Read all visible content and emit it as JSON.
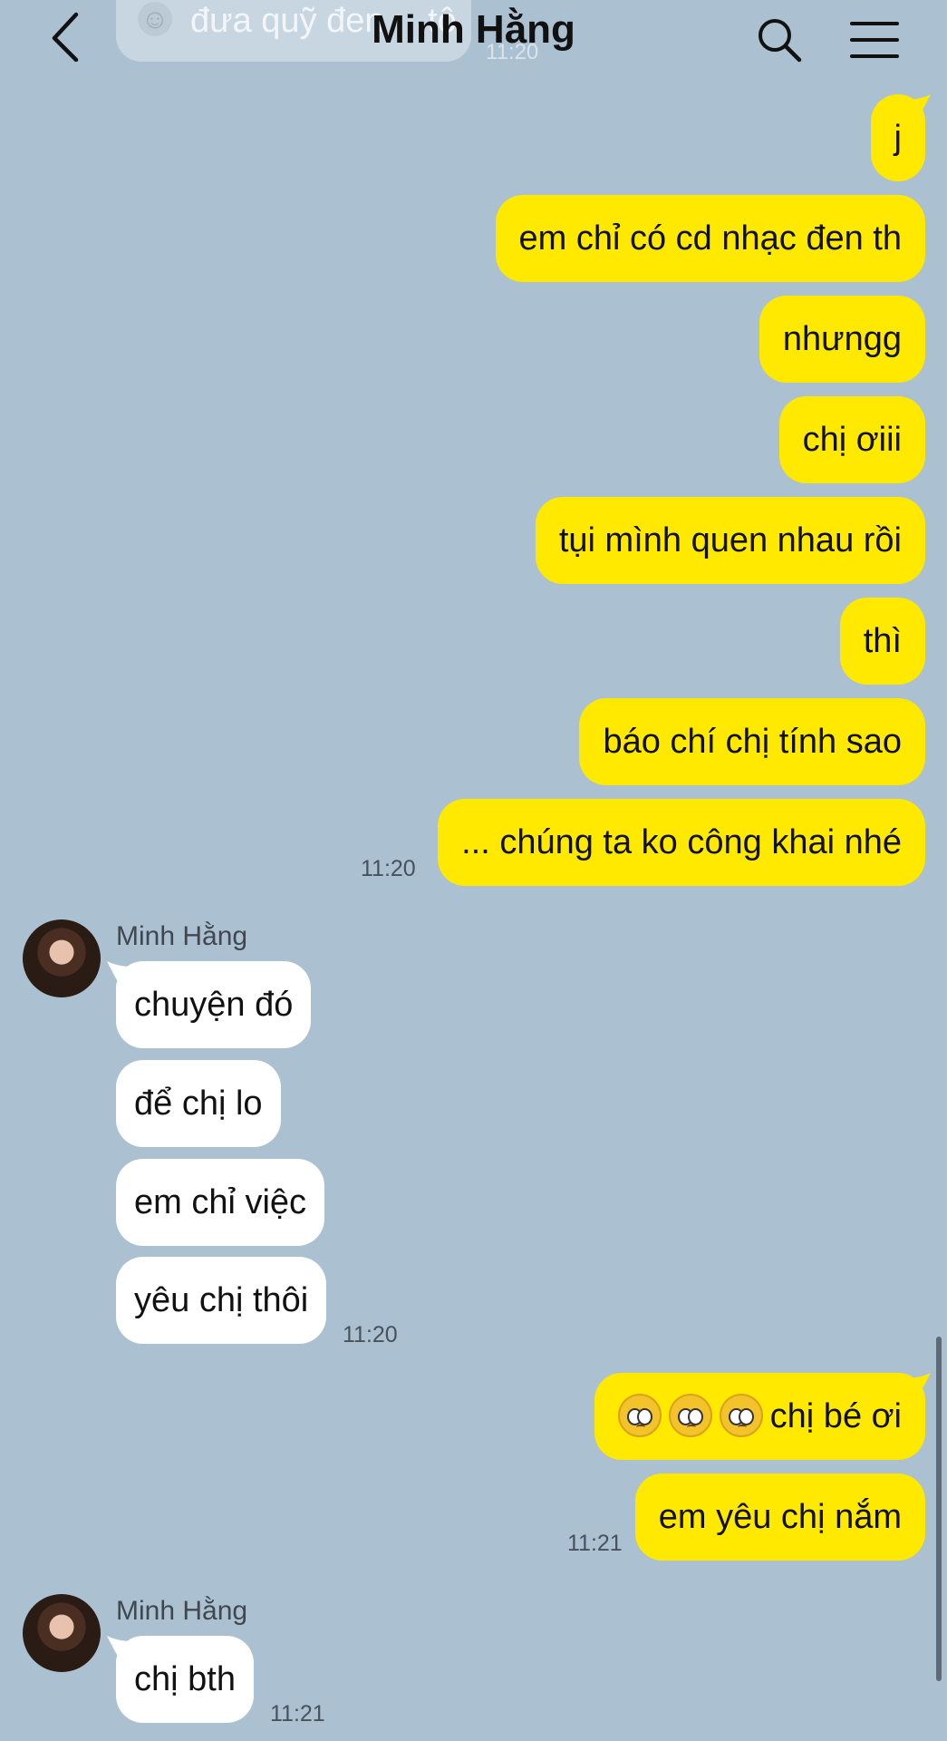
{
  "header": {
    "title": "Minh Hằng",
    "ghost_preview_text": "đưa quỹ đen …tô",
    "ghost_preview_time": "11:20"
  },
  "messages_out_1": [
    {
      "text": "j"
    },
    {
      "text": "em chỉ có cd nhạc đen th"
    },
    {
      "text": "nhưngg"
    },
    {
      "text": "chị ơiii"
    },
    {
      "text": "tụi mình quen nhau rồi"
    },
    {
      "text": "thì"
    },
    {
      "text": "báo chí chị tính sao"
    },
    {
      "text": "... chúng ta ko công khai nhé"
    }
  ],
  "time_out_1": "11:20",
  "incoming_1": {
    "sender": "Minh Hằng",
    "messages": [
      {
        "text": "chuyện đó"
      },
      {
        "text": "để chị lo"
      },
      {
        "text": "em chỉ việc"
      },
      {
        "text": "yêu chị thôi"
      }
    ],
    "time": "11:20"
  },
  "messages_out_2": [
    {
      "text": "chị bé ơi",
      "emoji": [
        "pleading-face",
        "pleading-face",
        "pleading-face"
      ]
    },
    {
      "text": "em yêu chị nắm"
    }
  ],
  "time_out_2": "11:21",
  "incoming_2": {
    "sender": "Minh Hằng",
    "messages": [
      {
        "text": "chị bth"
      }
    ],
    "time": "11:21"
  },
  "colors": {
    "background": "#abc1d1",
    "outgoing_bubble": "#ffe900",
    "incoming_bubble": "#ffffff"
  }
}
